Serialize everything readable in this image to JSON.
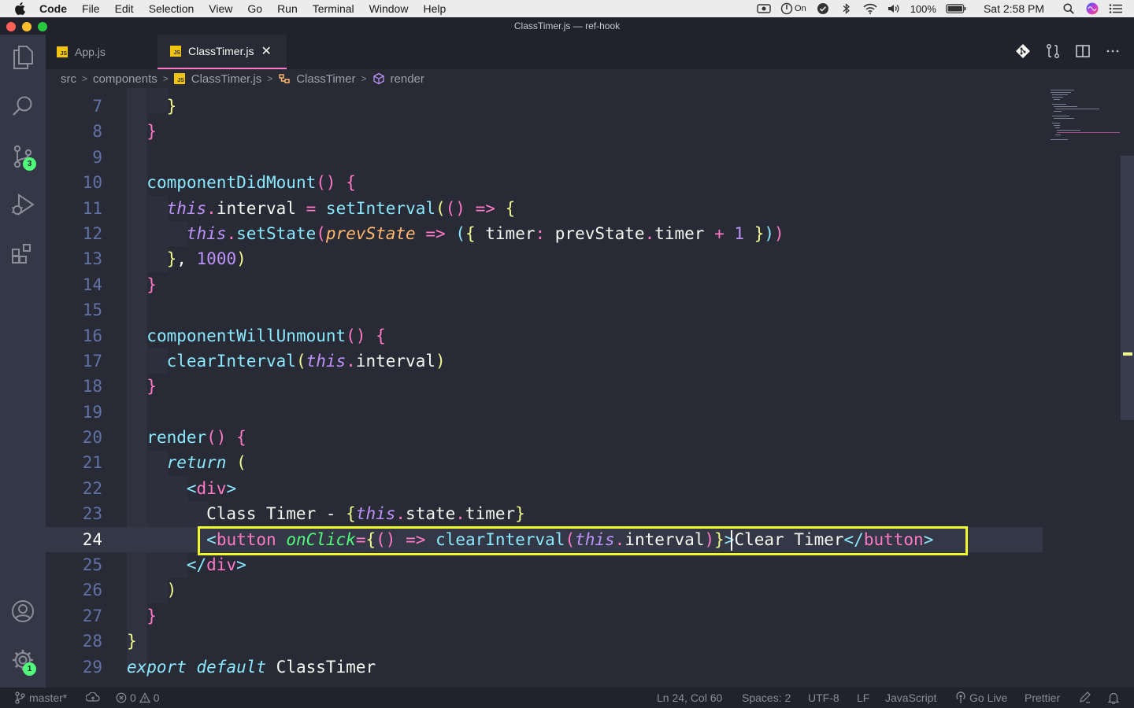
{
  "menubar": {
    "app_name": "Code",
    "items": [
      "File",
      "Edit",
      "Selection",
      "View",
      "Go",
      "Run",
      "Terminal",
      "Window",
      "Help"
    ],
    "status": {
      "focus_label": "On",
      "battery": "100%",
      "clock": "Sat 2:58 PM"
    }
  },
  "window": {
    "title": "ClassTimer.js — ref-hook"
  },
  "activity_bar": {
    "icons": [
      "files-icon",
      "search-icon",
      "source-control-icon",
      "run-debug-icon",
      "extensions-icon",
      "account-icon",
      "manage-gear-icon"
    ],
    "source_control_badge": "3",
    "manage_badge": "1"
  },
  "tabs": [
    {
      "label": "App.js",
      "active": false,
      "icon": "js-file-icon"
    },
    {
      "label": "ClassTimer.js",
      "active": true,
      "icon": "js-file-icon"
    }
  ],
  "tab_close_glyph": "✕",
  "breadcrumb": [
    "src",
    "components",
    "ClassTimer.js",
    "ClassTimer",
    "render"
  ],
  "editor": {
    "line_numbers": [
      "7",
      "8",
      "9",
      "10",
      "11",
      "12",
      "13",
      "14",
      "15",
      "16",
      "17",
      "18",
      "19",
      "20",
      "21",
      "22",
      "23",
      "24",
      "25",
      "26",
      "27",
      "28",
      "29"
    ],
    "active_line": "24",
    "code_lines": [
      "    }",
      "  }",
      "",
      "  componentDidMount() {",
      "    this.interval = setInterval(() => {",
      "      this.setState(prevState => ({ timer: prevState.timer + 1 }))",
      "    }, 1000)",
      "  }",
      "",
      "  componentWillUnmount() {",
      "    clearInterval(this.interval)",
      "  }",
      "",
      "  render() {",
      "    return (",
      "      <div>",
      "        Class Timer - {this.state.timer}",
      "        <button onClick={() => clearInterval(this.interval)}>Clear Timer</button>",
      "      </div>",
      "    )",
      "  }",
      "}",
      "export default ClassTimer"
    ],
    "highlight_color": "#f1fa2c"
  },
  "statusbar": {
    "branch": "master*",
    "errors": "0",
    "warnings": "0",
    "cursor_position": "Ln 24, Col 60",
    "indentation": "Spaces: 2",
    "encoding": "UTF-8",
    "eol": "LF",
    "language": "JavaScript",
    "go_live": "Go Live",
    "formatter": "Prettier"
  },
  "theme": {
    "background": "#282a36",
    "pink": "#ff79c6",
    "green": "#50fa7b",
    "purple": "#bd93f9",
    "yellow": "#f1fa8c",
    "cyan": "#8be9fd",
    "comment": "#6272a4"
  }
}
